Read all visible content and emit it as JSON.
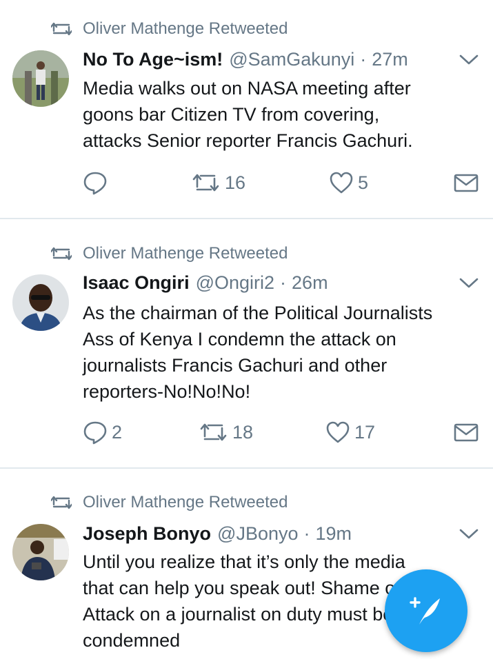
{
  "colors": {
    "muted": "#657786",
    "text": "#14171a",
    "divider": "#e1e8ed",
    "accent": "#1da1f2"
  },
  "tweets": [
    {
      "retweeted_by": "Oliver Mathenge Retweeted",
      "name": "No To Age~ism!",
      "handle": "@SamGakunyi",
      "separator": "·",
      "time": "27m",
      "text": "Media walks out on NASA meeting after\ngoons bar Citizen TV from covering,\nattacks Senior reporter Francis Gachuri.",
      "replies": "",
      "retweets": "16",
      "likes": "5",
      "avatar_icon": "avatar-photo"
    },
    {
      "retweeted_by": "Oliver Mathenge Retweeted",
      "name": "Isaac Ongiri",
      "handle": "@Ongiri2",
      "separator": "·",
      "time": "26m",
      "text": "As the chairman of the Political Journalists\nAss of Kenya I condemn the attack on\njournalists Francis Gachuri and other\nreporters-No!No!No!",
      "replies": "2",
      "retweets": "18",
      "likes": "17",
      "avatar_icon": "avatar-photo"
    },
    {
      "retweeted_by": "Oliver Mathenge Retweeted",
      "name": "Joseph Bonyo",
      "handle": "@JBonyo",
      "separator": "·",
      "time": "19m",
      "text": "Until you realize that it’s only the media\nthat can help you speak out! Shame on you!\nAttack on a journalist on duty must be\ncondemned",
      "avatar_icon": "avatar-photo"
    }
  ],
  "icons": {
    "retweet": "retweet-icon",
    "reply": "reply-icon",
    "like": "heart-icon",
    "message": "envelope-icon",
    "menu": "chevron-down-icon",
    "compose": "compose-tweet-icon"
  }
}
